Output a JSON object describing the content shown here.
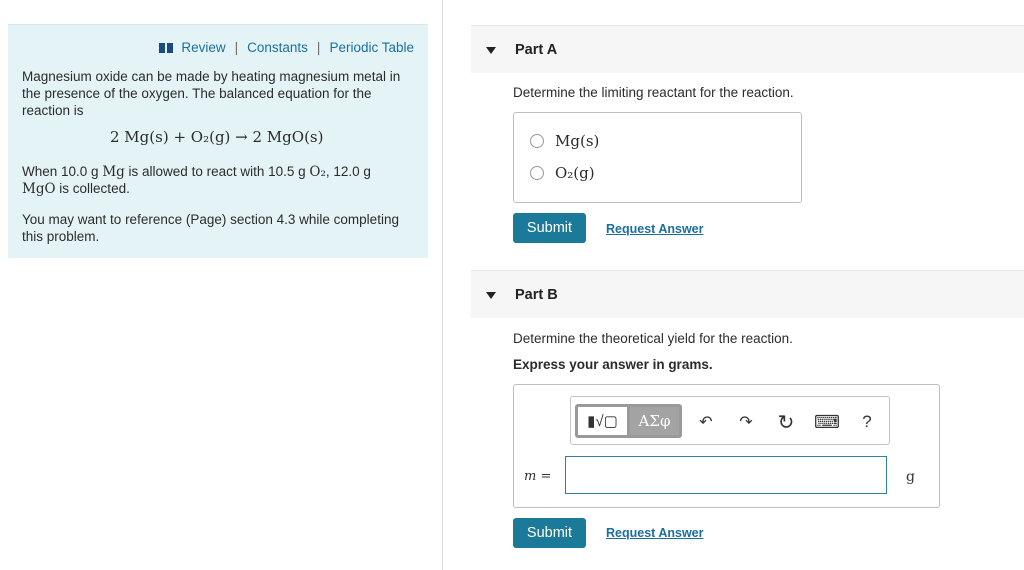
{
  "problem": {
    "links": {
      "review": "Review",
      "constants": "Constants",
      "periodic_table": "Periodic Table"
    },
    "intro_line1": "Magnesium oxide can be made by heating magnesium metal in",
    "intro_line2": "the presence of the oxygen. The balanced equation for the",
    "intro_line3": "reaction is",
    "equation": "2 Mg(s) + O₂(g)  →  2 MgO(s)",
    "given_a": "When 10.0 g ",
    "given_b": "Mg",
    "given_c": " is allowed to react with 10.5 g ",
    "given_d": "O₂",
    "given_e": ", 12.0 g",
    "given_f": "MgO",
    "given_g": " is collected.",
    "reference_line1": "You may want to reference (Page) section 4.3 while completing",
    "reference_line2": "this problem."
  },
  "part_a": {
    "title": "Part A",
    "question": "Determine the limiting reactant for the reaction.",
    "options": [
      "Mg(s)",
      "O₂(g)"
    ],
    "submit": "Submit",
    "request_answer": "Request Answer"
  },
  "part_b": {
    "title": "Part B",
    "question": "Determine the theoretical yield for the reaction.",
    "instruction": "Express your answer in grams.",
    "toolbar": {
      "templates": "▮√▢",
      "greek": "ΑΣφ",
      "undo": "↶",
      "redo": "↷",
      "reset": "↻",
      "keyboard": "⌨",
      "help": "?"
    },
    "variable_label": "m =",
    "input_value": "",
    "unit": "g",
    "submit": "Submit",
    "request_answer": "Request Answer"
  },
  "colors": {
    "panel_bg": "#e4f4f6",
    "submit_bg": "#1b7a9a",
    "link": "#1a6fa0"
  }
}
